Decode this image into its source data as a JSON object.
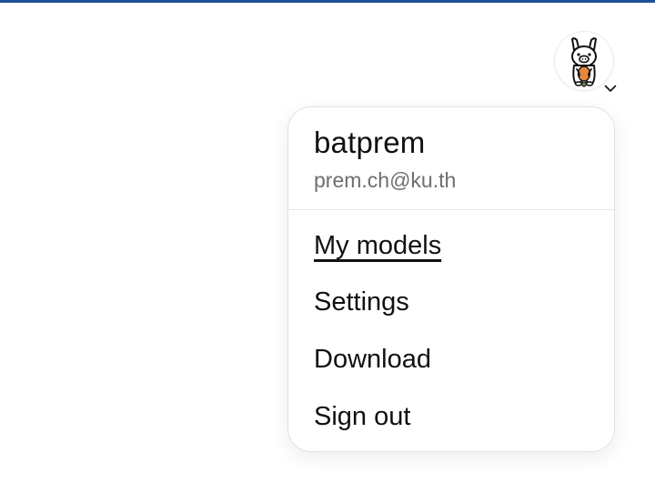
{
  "theme": {
    "top_bar_color": "#1f4f96",
    "text_color": "#111111",
    "muted_text_color": "#6e6e6e"
  },
  "header": {
    "avatar_icon": "llama-mascot-icon",
    "dropdown_icon": "chevron-down-icon"
  },
  "user_menu": {
    "username": "batprem",
    "email": "prem.ch@ku.th",
    "items": [
      {
        "label": "My models",
        "active": true
      },
      {
        "label": "Settings",
        "active": false
      },
      {
        "label": "Download",
        "active": false
      },
      {
        "label": "Sign out",
        "active": false
      }
    ]
  }
}
